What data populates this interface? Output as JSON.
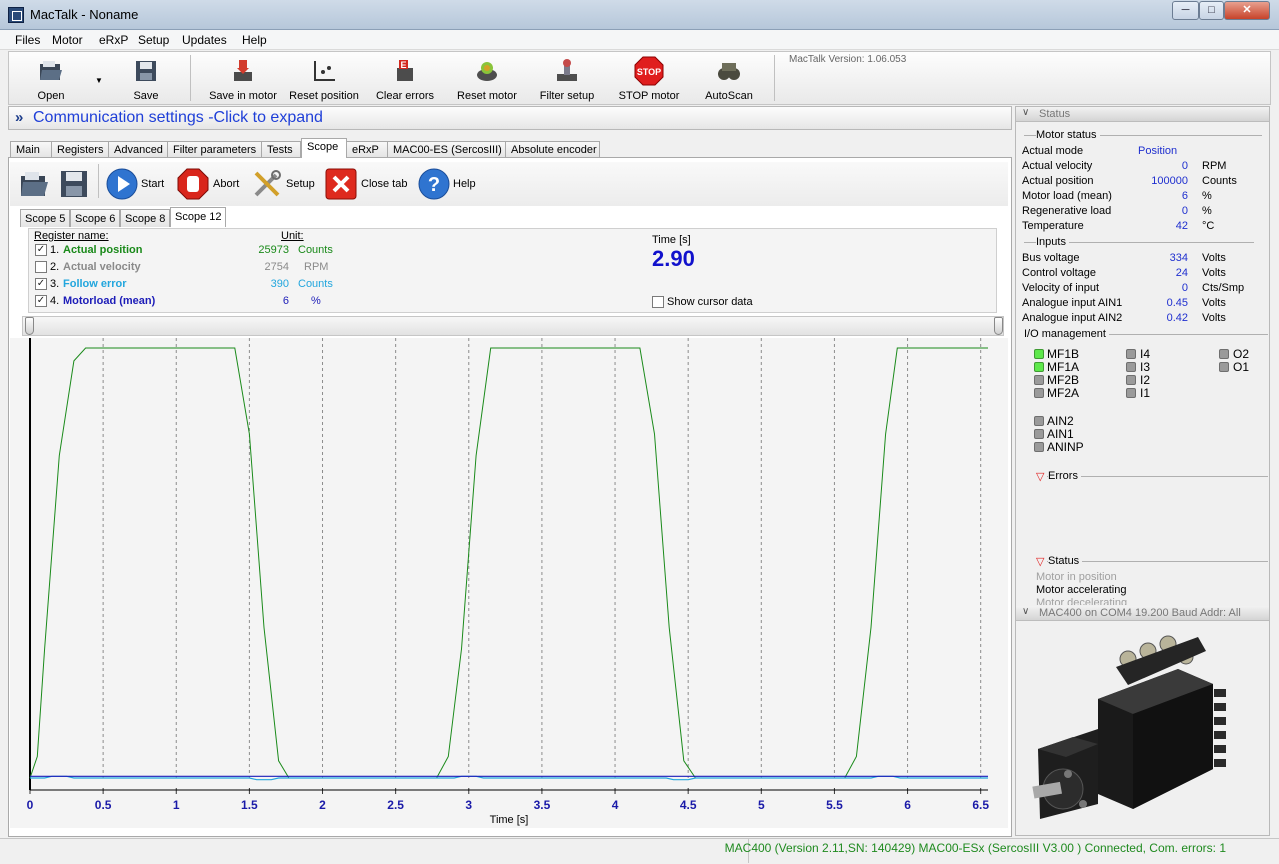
{
  "window": {
    "title": "MacTalk - Noname",
    "minimize": "─",
    "maximize": "□",
    "close": "✕"
  },
  "menu": [
    "Files",
    "Motor",
    "eRxP",
    "Setup",
    "Updates",
    "Help"
  ],
  "toolbar": {
    "open": "Open",
    "save": "Save",
    "save_in_motor": "Save in motor",
    "reset_position": "Reset position",
    "clear_errors": "Clear errors",
    "reset_motor": "Reset motor",
    "filter_setup": "Filter setup",
    "stop_motor": "STOP motor",
    "stop_sign": "STOP",
    "autoscan": "AutoScan",
    "version": "MacTalk Version: 1.06.053"
  },
  "comm": {
    "arrow": "»",
    "label": "Communication settings -Click to expand"
  },
  "tabs": [
    "Main",
    "Registers",
    "Advanced",
    "Filter parameters",
    "Tests",
    "Scope",
    "eRxP",
    "MAC00-ES (SercosIII)",
    "Absolute encoder"
  ],
  "active_tab": "Scope",
  "scope_toolbar": {
    "start": "Start",
    "abort": "Abort",
    "setup": "Setup",
    "close_tab": "Close tab",
    "help": "Help"
  },
  "scope_tabs": [
    "Scope 5",
    "Scope 6",
    "Scope 8",
    "Scope 12"
  ],
  "registers": {
    "name_header": "Register name:",
    "unit_header": "Unit:",
    "rows": [
      {
        "index": "1.",
        "name": "Actual position",
        "value": "25973",
        "unit": "Counts",
        "checked": true,
        "color": "#1a8a1a"
      },
      {
        "index": "2.",
        "name": "Actual velocity",
        "value": "2754",
        "unit": "RPM",
        "checked": false,
        "color": "#8a8a8a"
      },
      {
        "index": "3.",
        "name": "Follow error",
        "value": "390",
        "unit": "Counts",
        "checked": true,
        "color": "#22a6dd"
      },
      {
        "index": "4.",
        "name": "Motorload (mean)",
        "value": "6",
        "unit": "%",
        "checked": true,
        "color": "#1c1cb8"
      }
    ],
    "time_label": "Time [s]",
    "time_value": "2.90",
    "show_cursor": "Show cursor data"
  },
  "chart_data": {
    "type": "line",
    "xlabel": "Time [s]",
    "xlim": [
      0,
      6.55
    ],
    "xticks": [
      "0",
      "0.5",
      "1",
      "1.5",
      "2",
      "2.5",
      "3",
      "3.5",
      "4",
      "4.5",
      "5",
      "5.5",
      "6",
      "6.5"
    ],
    "ylim": [
      0,
      1
    ],
    "grid": "vertical dashed",
    "series": [
      {
        "name": "Actual position",
        "color": "#1a8a1a",
        "x": [
          0,
          0.05,
          0.1,
          0.2,
          0.3,
          0.38,
          1.4,
          1.5,
          1.6,
          1.7,
          1.77,
          2.78,
          2.86,
          2.95,
          3.05,
          3.15,
          4.17,
          4.27,
          4.37,
          4.47,
          4.55,
          5.57,
          5.65,
          5.75,
          5.85,
          5.93,
          6.55
        ],
        "y": [
          0,
          0.05,
          0.3,
          0.75,
          0.97,
          1,
          1,
          0.8,
          0.35,
          0.04,
          0,
          0,
          0.05,
          0.3,
          0.75,
          1,
          1,
          0.8,
          0.35,
          0.04,
          0,
          0,
          0.05,
          0.35,
          0.8,
          1,
          1
        ]
      },
      {
        "name": "Follow error",
        "color": "#22a6dd",
        "x": [
          0,
          0.1,
          0.15,
          0.25,
          0.3,
          1.5,
          1.55,
          1.65,
          1.7,
          2.9,
          2.95,
          3.05,
          3.1,
          4.35,
          4.4,
          4.5,
          4.55,
          5.75,
          5.8,
          5.9,
          5.95,
          6.55
        ],
        "y": [
          0.0,
          0.0,
          0.004,
          0.004,
          0.0,
          0.0,
          -0.004,
          -0.004,
          0.0,
          0.0,
          0.004,
          0.004,
          0.0,
          0.0,
          -0.004,
          -0.004,
          0.0,
          0.0,
          0.004,
          0.004,
          0.0,
          0.0
        ]
      },
      {
        "name": "Motorload (mean)",
        "color": "#1c1cb8",
        "x": [
          0,
          6.55
        ],
        "y": [
          0.004,
          0.004
        ]
      }
    ]
  },
  "status": {
    "header": "Status",
    "motor_status_label": "Motor status",
    "motor": [
      {
        "label": "Actual mode",
        "value": "Position",
        "unit": ""
      },
      {
        "label": "Actual velocity",
        "value": "0",
        "unit": "RPM"
      },
      {
        "label": "Actual position",
        "value": "100000",
        "unit": "Counts"
      },
      {
        "label": "Motor load (mean)",
        "value": "6",
        "unit": "%"
      },
      {
        "label": "Regenerative load",
        "value": "0",
        "unit": "%"
      },
      {
        "label": "Temperature",
        "value": "42",
        "unit": "°C"
      }
    ],
    "inputs_label": "Inputs",
    "inputs": [
      {
        "label": "Bus voltage",
        "value": "334",
        "unit": "Volts"
      },
      {
        "label": "Control voltage",
        "value": "24",
        "unit": "Volts"
      },
      {
        "label": "Velocity of input",
        "value": "0",
        "unit": "Cts/Smp"
      },
      {
        "label": "Analogue input AIN1",
        "value": "0.45",
        "unit": "Volts"
      },
      {
        "label": "Analogue input AIN2",
        "value": "0.42",
        "unit": "Volts"
      }
    ],
    "io_label": "I/O management",
    "io_col1": [
      {
        "name": "MF1B",
        "on": true
      },
      {
        "name": "MF1A",
        "on": true
      },
      {
        "name": "MF2B",
        "on": false
      },
      {
        "name": "MF2A",
        "on": false
      }
    ],
    "io_col2": [
      {
        "name": "I4",
        "on": false
      },
      {
        "name": "I3",
        "on": false
      },
      {
        "name": "I2",
        "on": false
      },
      {
        "name": "I1",
        "on": false
      }
    ],
    "io_col3": [
      {
        "name": "O2",
        "on": false
      },
      {
        "name": "O1",
        "on": false
      }
    ],
    "io_analog": [
      {
        "name": "AIN2",
        "on": false
      },
      {
        "name": "AIN1",
        "on": false
      },
      {
        "name": "ANINP",
        "on": false
      }
    ],
    "errors_label": "Errors",
    "status_label": "Status",
    "status_items": [
      "Motor in position",
      "Motor accelerating",
      "Motor decelerating"
    ],
    "device_header": "MAC400 on COM4 19.200 Baud Addr: All"
  },
  "statusbar": "MAC400 (Version 2.11,SN: 140429) MAC00-ESx (SercosIII V3.00 ) Connected, Com. errors: 1"
}
